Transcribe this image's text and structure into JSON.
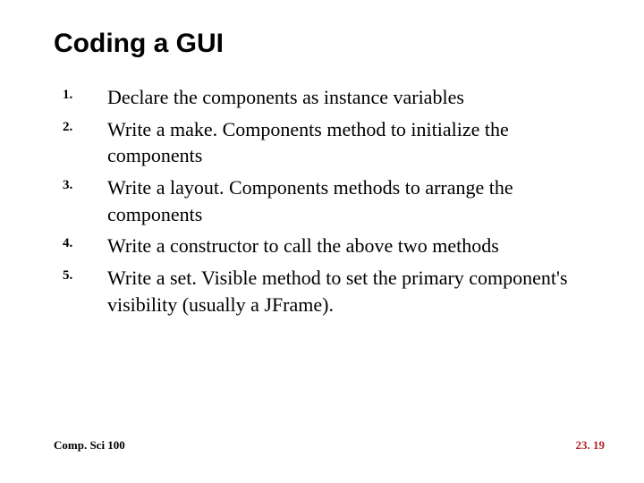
{
  "title": "Coding a GUI",
  "items": [
    {
      "num": "1.",
      "text": "Declare the components as instance variables"
    },
    {
      "num": "2.",
      "text": "Write a make. Components method to initialize the components"
    },
    {
      "num": "3.",
      "text": "Write a layout. Components methods to arrange the components"
    },
    {
      "num": "4.",
      "text": "Write a constructor to call the above two methods"
    },
    {
      "num": "5.",
      "text": "Write a set. Visible method to set the primary component's visibility (usually a JFrame)."
    }
  ],
  "footer": {
    "left": "Comp. Sci 100",
    "right": "23. 19"
  }
}
